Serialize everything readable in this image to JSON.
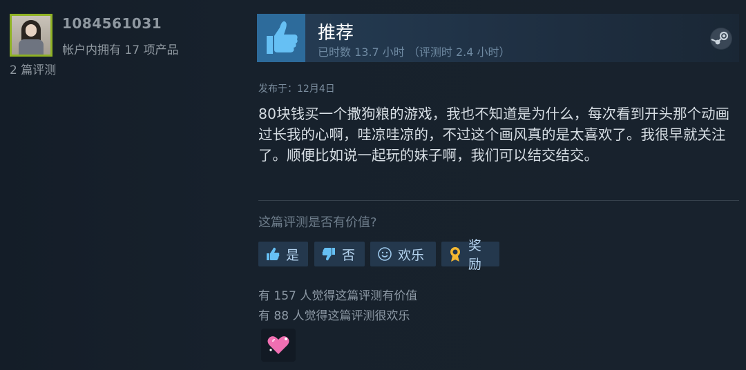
{
  "user": {
    "name": "1084561031",
    "products_owned": "帐户内拥有 17 项产品",
    "review_count": "2 篇评测"
  },
  "review": {
    "verdict": "推荐",
    "playtime": "已时数 13.7 小时 （评测时 2.4 小时）",
    "posted": "发布于：12月4日",
    "body": "80块钱买一个撒狗粮的游戏，我也不知道是为什么，每次看到开头那个动画过长我的心啊，哇凉哇凉的，不过这个画风真的是太喜欢了。我很早就关注了。顺便比如说一起玩的妹子啊，我们可以结交结交。"
  },
  "feedback": {
    "question": "这篇评测是否有价值?",
    "yes_label": "是",
    "no_label": "否",
    "funny_label": "欢乐",
    "award_label": "奖励",
    "helpful_count": "有 157 人觉得这篇评测有价值",
    "funny_count": "有 88 人觉得这篇评测很欢乐"
  },
  "icons": {
    "thumb": "thumbs-up-icon",
    "steam": "steam-logo-icon",
    "award": "heart-award-icon"
  },
  "colors": {
    "accent": "#66c0f4",
    "thumb_box": "#2d6b9b",
    "award_pink": "#f06fb2",
    "award_gold": "#f5b830"
  }
}
